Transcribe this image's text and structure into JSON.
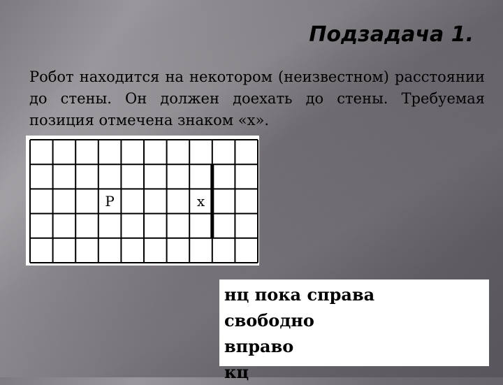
{
  "slide": {
    "title": "Подзадача 1.",
    "description": "Робот находится на некотором (неизвестном) расстоянии до стены. Он должен доехать до стены. Требуемая позиция отмечена знаком «x».",
    "grid": {
      "rows": 5,
      "cols": 10,
      "robot": {
        "label": "Р",
        "row": 2,
        "col": 3
      },
      "target": {
        "label": "x",
        "row": 2,
        "col": 7
      },
      "wall": {
        "orientation": "vertical",
        "after_col": 7,
        "from_row": 1,
        "to_row": 3
      }
    },
    "code": [
      "нц пока справа",
      "свободно",
      "вправо",
      "кц"
    ]
  }
}
